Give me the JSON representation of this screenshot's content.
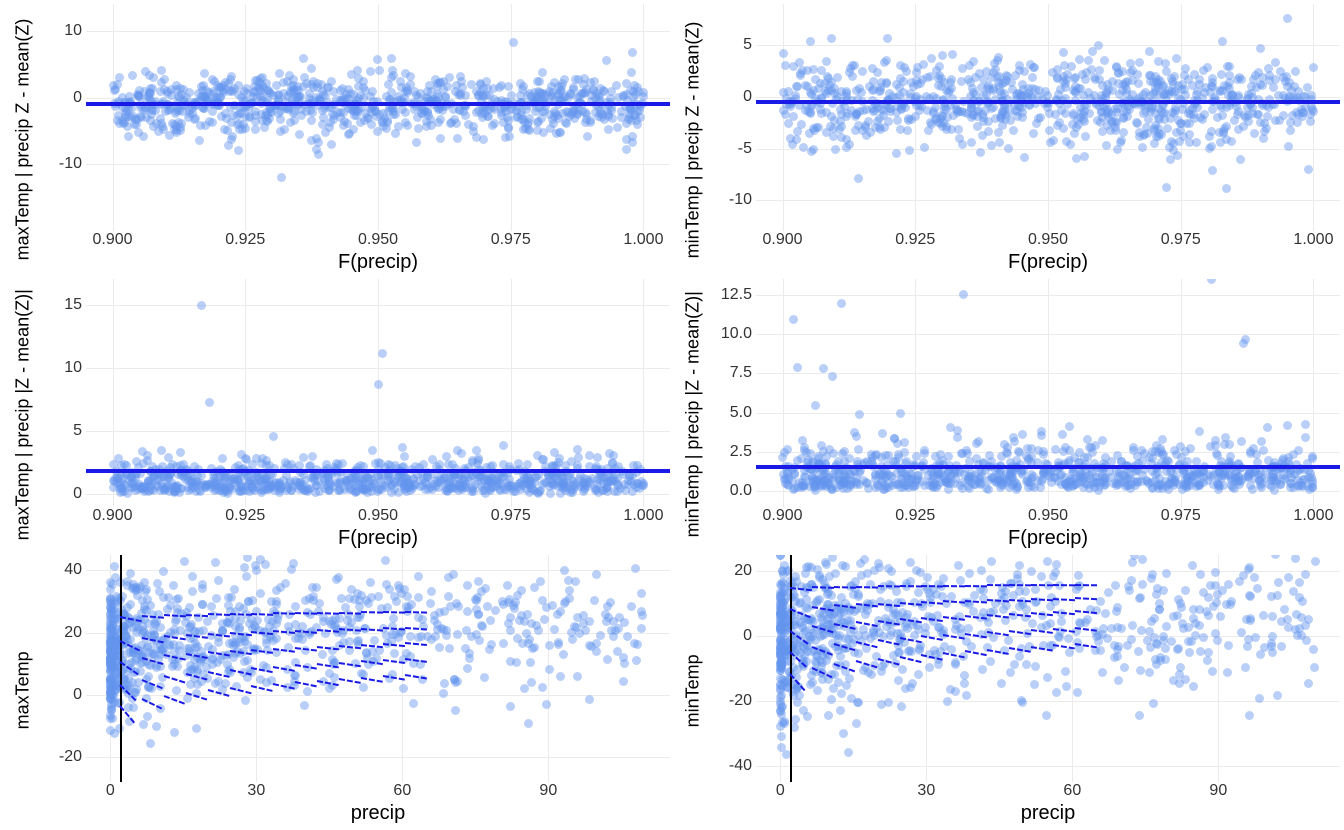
{
  "chart_data": [
    {
      "id": "panel-0-0",
      "type": "scatter",
      "xlabel": "F(precip)",
      "ylabel": "maxTemp | precip  Z - mean(Z)",
      "xlim": [
        0.895,
        1.005
      ],
      "ylim": [
        -20,
        14
      ],
      "xticks": [
        0.9,
        0.925,
        0.95,
        0.975,
        1.0
      ],
      "yticks": [
        -10,
        0,
        10
      ],
      "hline": -1.0,
      "n_points": 2200,
      "point_spread": "dense horizontal band centered near -1, range roughly -10..10, a few outliers to -18 and +11"
    },
    {
      "id": "panel-0-1",
      "type": "scatter",
      "xlabel": "F(precip)",
      "ylabel": "minTemp | precip  Z - mean(Z)",
      "xlim": [
        0.895,
        1.005
      ],
      "ylim": [
        -13,
        9
      ],
      "xticks": [
        0.9,
        0.925,
        0.95,
        0.975,
        1.0
      ],
      "yticks": [
        -10,
        -5,
        0,
        5
      ],
      "hline": -0.5,
      "n_points": 2200,
      "point_spread": "dense horizontal band centered near 0, range roughly -7..6, outliers to -12 and +7"
    },
    {
      "id": "panel-1-0",
      "type": "scatter",
      "xlabel": "F(precip)",
      "ylabel": "maxTemp | precip  |Z - mean(Z)|",
      "xlim": [
        0.895,
        1.005
      ],
      "ylim": [
        -1,
        17
      ],
      "xticks": [
        0.9,
        0.925,
        0.95,
        0.975,
        1.0
      ],
      "yticks": [
        0,
        5,
        10,
        15
      ],
      "hline": 1.8,
      "n_points": 2200,
      "point_spread": "dense near 0-3, thinning up to ~8, a few outliers 11-16"
    },
    {
      "id": "panel-1-1",
      "type": "scatter",
      "xlabel": "F(precip)",
      "ylabel": "minTemp | precip  |Z - mean(Z)|",
      "xlim": [
        0.895,
        1.005
      ],
      "ylim": [
        -1,
        13.5
      ],
      "xticks": [
        0.9,
        0.925,
        0.95,
        0.975,
        1.0
      ],
      "yticks": [
        0.0,
        2.5,
        5.0,
        7.5,
        10.0,
        12.5
      ],
      "hline": 1.5,
      "n_points": 2200,
      "point_spread": "dense near 0-2.5, thinning to ~6, outliers 8-12.5"
    },
    {
      "id": "panel-2-0",
      "type": "scatter",
      "xlabel": "precip",
      "ylabel": "maxTemp",
      "xlim": [
        -5,
        115
      ],
      "ylim": [
        -28,
        45
      ],
      "xticks": [
        0,
        30,
        60,
        90
      ],
      "yticks": [
        -20,
        0,
        20,
        40
      ],
      "vline": 2.0,
      "dashed_curves": 5,
      "dashed_range_x": [
        2,
        65
      ],
      "dashed_range_y_start": [
        -5,
        2,
        10,
        17,
        25
      ],
      "dashed_range_y_end": [
        7,
        12,
        17,
        22,
        27
      ],
      "n_points": 1800,
      "point_spread": "vertical dense strip at low x fanning out; most points x<30, some to x~110"
    },
    {
      "id": "panel-2-1",
      "type": "scatter",
      "xlabel": "precip",
      "ylabel": "minTemp",
      "xlim": [
        -5,
        115
      ],
      "ylim": [
        -45,
        25
      ],
      "xticks": [
        0,
        30,
        60,
        90
      ],
      "yticks": [
        -40,
        -20,
        0,
        20
      ],
      "vline": 2.0,
      "dashed_curves": 5,
      "dashed_range_x": [
        2,
        65
      ],
      "dashed_range_y_start": [
        -13,
        -6,
        1,
        8,
        15
      ],
      "dashed_range_y_end": [
        -2,
        3,
        8,
        12,
        16
      ],
      "n_points": 1800,
      "point_spread": "vertical dense strip at low x spanning -40..20, fanning right; outliers to x~110"
    }
  ],
  "colors": {
    "point": "rgba(100,149,237,0.45)",
    "line": "#1a1ae6",
    "grid": "#ebebeb"
  }
}
